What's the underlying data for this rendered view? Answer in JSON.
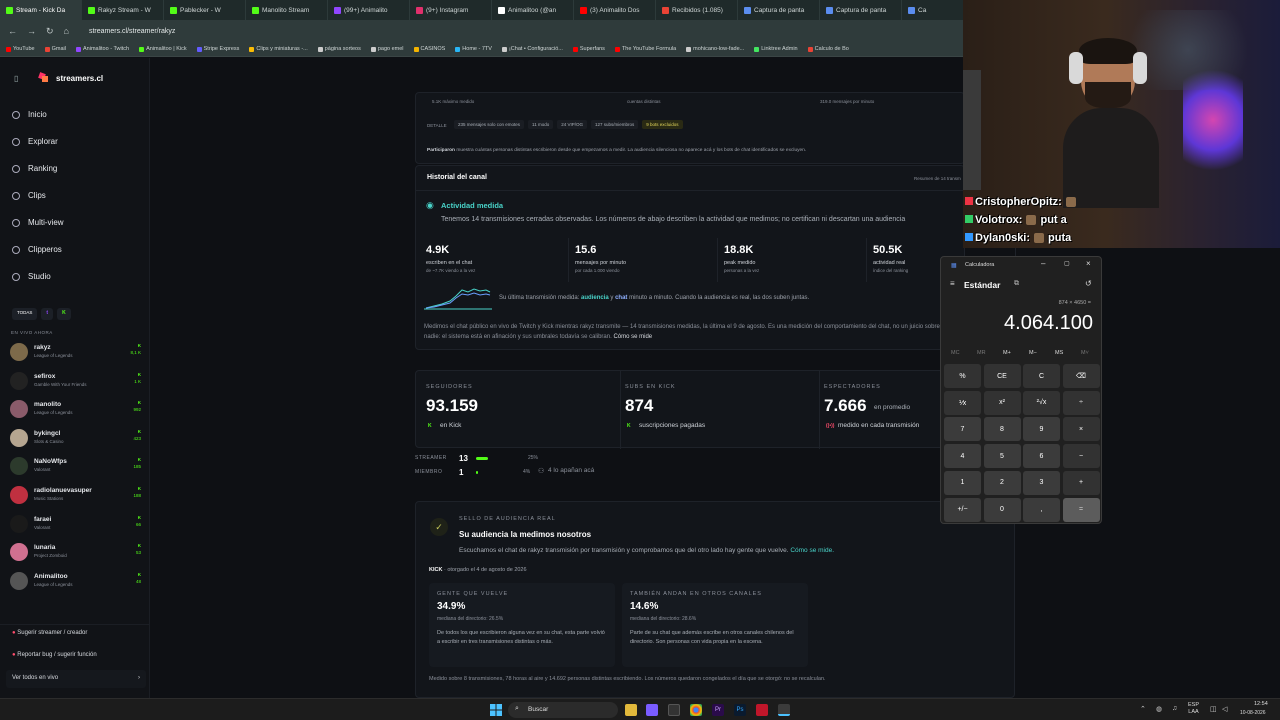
{
  "browser": {
    "tabs": [
      {
        "label": "Stream - Kick Da",
        "color": "#53fc18"
      },
      {
        "label": "Rakyz Stream - W",
        "color": "#53fc18"
      },
      {
        "label": "Pablecker - W",
        "color": "#53fc18"
      },
      {
        "label": "Manolito Stream",
        "color": "#53fc18"
      },
      {
        "label": "(99+) Animalito",
        "color": "#9146ff"
      },
      {
        "label": "(9+) Instagram",
        "color": "#e1306c"
      },
      {
        "label": "Animalitoo (@an",
        "color": "#ffffff"
      },
      {
        "label": "(3) Animalito Dos",
        "color": "#ff0000"
      },
      {
        "label": "Recibidos (1.085)",
        "color": "#ea4335"
      },
      {
        "label": "Captura de panta",
        "color": "#5b8def"
      },
      {
        "label": "Captura de panta",
        "color": "#5b8def"
      },
      {
        "label": "Ca",
        "color": "#5b8def"
      }
    ],
    "url": "streamers.cl/streamer/rakyz",
    "bookmarks": [
      {
        "label": "YouTube",
        "color": "#ff0000"
      },
      {
        "label": "Gmail",
        "color": "#ea4335"
      },
      {
        "label": "Animalitoo - Twitch",
        "color": "#9146ff"
      },
      {
        "label": "Animalitoo | Kick",
        "color": "#53fc18"
      },
      {
        "label": "Stripe Express",
        "color": "#635bff"
      },
      {
        "label": "Clips y miniaturas -...",
        "color": "#fbbc04"
      },
      {
        "label": "página sorteos",
        "color": "#cccccc"
      },
      {
        "label": "pago emel",
        "color": "#cccccc"
      },
      {
        "label": "CASINOS",
        "color": "#f4b400"
      },
      {
        "label": "Home - 7TV",
        "color": "#29b6f6"
      },
      {
        "label": "¡Chat • Configuració...",
        "color": "#cccccc"
      },
      {
        "label": "Superfans",
        "color": "#ff0000"
      },
      {
        "label": "The YouTube Formula",
        "color": "#ff0000"
      },
      {
        "label": "mohicano-low-fade...",
        "color": "#cccccc"
      },
      {
        "label": "Linktree Admin",
        "color": "#43e660"
      },
      {
        "label": "Calculo de Bo",
        "color": "#ea4335"
      }
    ]
  },
  "site": {
    "brand": "streamers.cl",
    "nav": [
      "Inicio",
      "Explorar",
      "Ranking",
      "Clips",
      "Multi-view",
      "Clipperos",
      "Studio"
    ],
    "filters": [
      "TODAS"
    ],
    "live_title": "EN VIVO AHORA",
    "live": [
      {
        "name": "rakyz",
        "game": "League of Legends",
        "viewers": "8,1 K",
        "color": "#7d6a4a"
      },
      {
        "name": "sefirox",
        "game": "Gamble With Your Friends",
        "viewers": "1 K",
        "color": "#222"
      },
      {
        "name": "manolito",
        "game": "League of Legends",
        "viewers": "992",
        "color": "#8a5b6a"
      },
      {
        "name": "bykingcl",
        "game": "Slots & Casino",
        "viewers": "423",
        "color": "#b5a590"
      },
      {
        "name": "NaNoWfps",
        "game": "Valorant",
        "viewers": "185",
        "color": "#2c3a2c"
      },
      {
        "name": "radiolanuevasuper",
        "game": "Music Stations",
        "viewers": "188",
        "color": "#c03040"
      },
      {
        "name": "faraei",
        "game": "Valorant",
        "viewers": "66",
        "color": "#1a1a1a"
      },
      {
        "name": "lunaria",
        "game": "Project Zomboid",
        "viewers": "53",
        "color": "#d07090"
      },
      {
        "name": "Animalitoo",
        "game": "League of Legends",
        "viewers": "48",
        "color": "#555"
      }
    ],
    "bottom_links": [
      "Sugerir streamer / creador",
      "Reportar bug / sugerir función",
      "Ver todos en vivo"
    ],
    "top_stats": {
      "labels": [
        "5.1K máximo medido",
        "cuentas distintas",
        "319.0 mensajes por minuto"
      ],
      "detail_label": "DETALLE",
      "details": [
        "235 mensajes solo con emotes",
        "11 modo",
        "24 VIP/OG",
        "127 subs/miembros",
        "9 bots excluidos"
      ],
      "participaron_title": "Participaron",
      "participaron": "muestra cuántas personas distintas escribieron desde que empezamos a medir. La audiencia silenciosa no aparece acá y los bots de chat identificados se excluyen."
    },
    "history": {
      "title": "Historial del canal",
      "right": "Resumen de 14 transm",
      "activity_title": "Actividad medida",
      "activity_desc": "Tenemos 14 transmisiones cerradas observadas. Los números de abajo describen la actividad que medimos; no certifican ni descartan una audiencia",
      "stats": [
        {
          "value": "4.9K",
          "label": "escriben en el chat",
          "sub": "de ~7.7K viendo a la vez"
        },
        {
          "value": "15.6",
          "label": "mensajes por minuto",
          "sub": "por cada 1.000 viendo"
        },
        {
          "value": "18.8K",
          "label": "peak medido",
          "sub": "personas a la vez"
        },
        {
          "value": "50.5K",
          "label": "actividad real",
          "sub": "índice del ranking"
        }
      ],
      "spark_note_1": "Su última transmisión medida:",
      "spark_note_audiencia": "audiencia",
      "spark_note_2": "y",
      "spark_note_chat": "chat",
      "spark_note_3": "minuto a minuto. Cuando la audiencia es real, las dos suben juntas.",
      "footnote": "Medimos el chat público en vivo de Twitch y Kick mientras rakyz transmite — 14 transmisiones medidas, la última el 9 de agosto. Es una medición del comportamiento del chat, no un juicio sobre nadie: el sistema está en afinación y sus umbrales todavía se calibran.",
      "footnote_link": "Cómo se mide"
    },
    "followers": [
      {
        "label": "SEGUIDORES",
        "value": "93.159",
        "suffix": "",
        "sub": "en Kick"
      },
      {
        "label": "SUBS EN KICK",
        "value": "874",
        "suffix": "",
        "sub": "suscripciones pagadas"
      },
      {
        "label": "ESPECTADORES",
        "value": "7.666",
        "suffix": "en promedio",
        "sub": "medido en cada transmisión"
      }
    ],
    "roles": [
      {
        "label": "STREAMER",
        "count": "13",
        "pct": "25%",
        "fill": 0.25
      },
      {
        "label": "MIEMBRO",
        "count": "1",
        "pct": "4%",
        "fill": 0.04
      }
    ],
    "roles_note": "4 lo apañan acá",
    "seal": {
      "kicker": "SELLO DE AUDIENCIA REAL",
      "title": "Su audiencia la medimos nosotros",
      "desc": "Escuchamos el chat de rakyz transmisión por transmisión y comprobamos que del otro lado hay gente que vuelve.",
      "link": "Cómo se mide.",
      "platform": "KICK",
      "granted": "· otorgado el 4 de agosto de 2026",
      "cards": [
        {
          "kicker": "GENTE QUE VUELVE",
          "value": "34.9%",
          "median": "mediana del directorio: 26.5%",
          "desc": "De todos los que escribieron alguna vez en su chat, esta parte volvió a escribir en tres transmisiones distintas o más."
        },
        {
          "kicker": "TAMBIÉN ANDAN EN OTROS CANALES",
          "value": "14.6%",
          "median": "mediana del directorio: 28.6%",
          "desc": "Parte de su chat que además escribe en otros canales chilenos del directorio. Son personas con vida propia en la escena."
        }
      ],
      "footer": "Medido sobre 8 transmisiones, 78 horas al aire y 14.692 personas distintas escribiendo. Los números quedaron congelados el día que se otorgó: no se recalculan."
    }
  },
  "calculator": {
    "title": "Calculadora",
    "mode": "Estándar",
    "expression": "874 × 4650 =",
    "display": "4.064.100",
    "memory": [
      "MC",
      "MR",
      "M+",
      "M−",
      "MS",
      "M˅"
    ],
    "keys": [
      "%",
      "CE",
      "C",
      "⌫",
      "⅟x",
      "x²",
      "²√x",
      "÷",
      "7",
      "8",
      "9",
      "×",
      "4",
      "5",
      "6",
      "−",
      "1",
      "2",
      "3",
      "+",
      "+/−",
      "0",
      ",",
      "="
    ]
  },
  "chat": [
    {
      "user": "CristopherOpitz:",
      "msg": ""
    },
    {
      "user": "Volotrox:",
      "msg": "put a"
    },
    {
      "user": "Dylan0ski:",
      "msg": "puta"
    }
  ],
  "taskbar": {
    "search": "Buscar",
    "lang": "ESP\nLAA",
    "time": "12:54",
    "date": "10-08-2026"
  }
}
